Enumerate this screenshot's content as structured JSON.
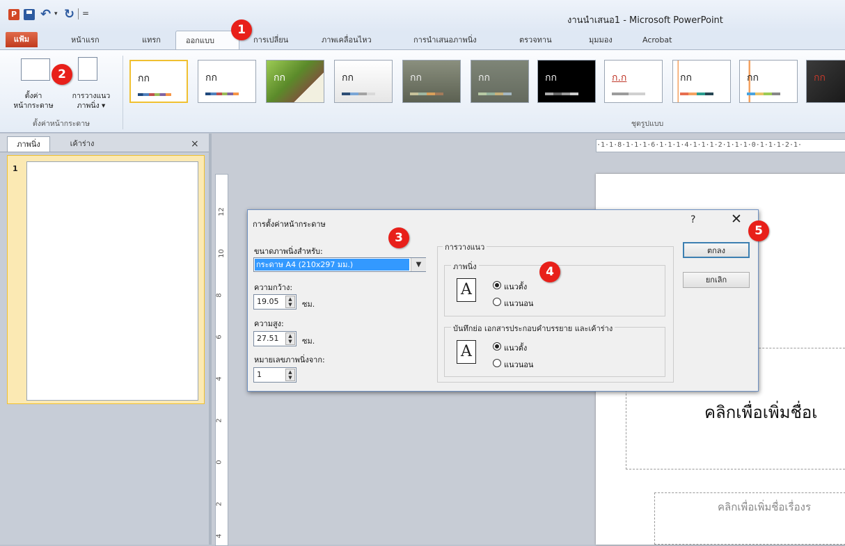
{
  "window": {
    "title": "งานนำเสนอ1 - Microsoft PowerPoint"
  },
  "quick_access": {
    "app_icon": "P",
    "undo_dropdown": "▾",
    "customize": "="
  },
  "tabs": [
    {
      "label": "แฟ้ม"
    },
    {
      "label": "หน้าแรก"
    },
    {
      "label": "แทรก"
    },
    {
      "label": "ออกแบบ"
    },
    {
      "label": "การเปลี่ยน"
    },
    {
      "label": "ภาพเคลื่อนไหว"
    },
    {
      "label": "การนำเสนอภาพนิ่ง"
    },
    {
      "label": "ตรวจทาน"
    },
    {
      "label": "มุมมอง"
    },
    {
      "label": "Acrobat"
    }
  ],
  "ribbon": {
    "page_setup_label": "ตั้งค่าหน้ากระดาษ",
    "page_setup_button_line1": "ตั้งค่า",
    "page_setup_button_line2": "หน้ากระดาษ",
    "orientation_button_line1": "การวางแนว",
    "orientation_button_line2": "ภาพนิ่ง ▾",
    "themes_group_label": "ชุดรูปแบบ",
    "theme_sample_text": "กก",
    "theme_sample_alt": "ก.ก"
  },
  "panel": {
    "tab_slides": "ภาพนิ่ง",
    "tab_outline": "เค้าร่าง",
    "close": "×",
    "slide_number": "1"
  },
  "ruler": {
    "horizontal": "·1·1·8·1·1·1·6·1·1·1·4·1·1·1·2·1·1·1·0·1·1·1·2·1·",
    "vertical_labels": [
      "12",
      "10",
      "8",
      "6",
      "4",
      "2",
      "0",
      "2",
      "4"
    ]
  },
  "slide": {
    "title_placeholder": "คลิกเพื่อเพิ่มชื่อเ",
    "subtitle_placeholder": "คลิกเพื่อเพิ่มชื่อเรื่องร"
  },
  "dialog": {
    "title": "การตั้งค่าหน้ากระดาษ",
    "help": "?",
    "close": "✕",
    "size_label": "ขนาดภาพนิ่งสำหรับ:",
    "size_value": "กระดาษ A4 (210x297 มม.)",
    "width_label": "ความกว้าง:",
    "width_value": "19.05",
    "height_label": "ความสูง:",
    "height_value": "27.51",
    "unit": "ซม.",
    "number_from_label": "หมายเลขภาพนิ่งจาก:",
    "number_from_value": "1",
    "orientation_label": "การวางแนว",
    "slides_label": "ภาพนิ่ง",
    "slides_portrait": "แนวตั้ง",
    "slides_landscape": "แนวนอน",
    "notes_label": "บันทึกย่อ เอกสารประกอบคำบรรยาย และเค้าร่าง",
    "notes_portrait": "แนวตั้ง",
    "notes_landscape": "แนวนอน",
    "icon_letter": "A",
    "ok": "ตกลง",
    "cancel": "ยกเลิก"
  },
  "callouts": [
    "1",
    "2",
    "3",
    "4",
    "5"
  ],
  "colors": {
    "callout": "#e8201a",
    "file_tab": "#c13b1e",
    "selection": "#3399ff",
    "slide_selection": "#f0c030"
  }
}
